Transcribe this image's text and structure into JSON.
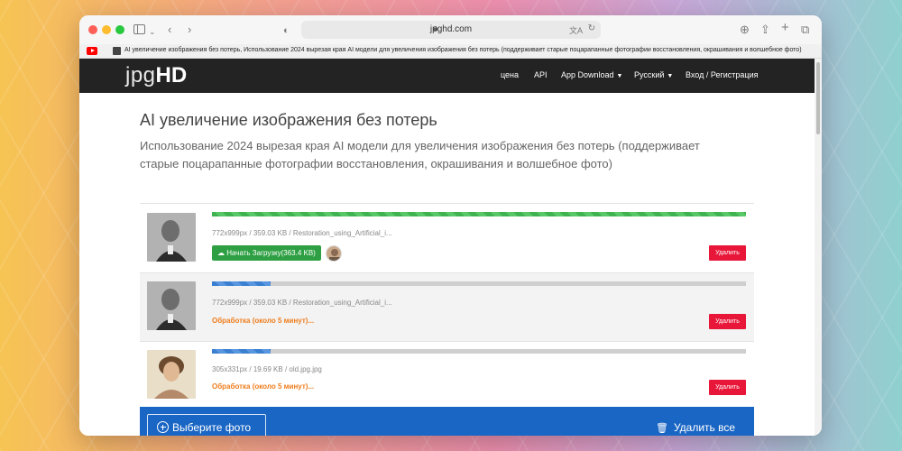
{
  "browser": {
    "url": "jpghd.com",
    "lock_icon": "shield-icon",
    "tab_title": "AI увеличение изображения без потерь, Использование 2024 вырезая края AI модели для увеличения изображения без потерь (поддерживает старые поцарапанные фотографии восстановления, окрашивания и волшебное фото)"
  },
  "nav": {
    "logo_light": "jpg",
    "logo_bold": "HD",
    "links": [
      "цена",
      "API",
      "App Download",
      "Русский",
      "Вход / Регистрация"
    ]
  },
  "hero": {
    "title": "AI увеличение изображения без потерь",
    "subtitle": "Использование 2024 вырезая края AI модели для увеличения изображения без потерь (поддерживает старые поцарапанные фотографии восстановления, окрашивания и волшебное фото)"
  },
  "files": [
    {
      "meta": "772x999px / 359.03 KB / Restoration_using_Artificial_i...",
      "progress": 1.0,
      "state": "done",
      "download_label": "Начать Загрузку(363.4 KB)",
      "delete_label": "Удалить"
    },
    {
      "meta": "772x999px / 359.03 KB / Restoration_using_Artificial_i...",
      "progress": 0.11,
      "state": "processing",
      "status": "Обработка (около 5 минут)...",
      "delete_label": "Удалить"
    },
    {
      "meta": "305x331px / 19.69 KB / old.jpg.jpg",
      "progress": 0.11,
      "state": "processing",
      "status": "Обработка (около 5 минут)...",
      "delete_label": "Удалить"
    }
  ],
  "actions": {
    "choose_label": "Выберите фото",
    "delete_all_label": "Удалить все"
  },
  "colors": {
    "nav_bg": "#232323",
    "done_green": "#3fb34f",
    "processing_blue": "#3a7fd0",
    "status_orange": "#f07c1c",
    "delete_red": "#e8173a",
    "bottom_blue": "#1a66c4"
  }
}
